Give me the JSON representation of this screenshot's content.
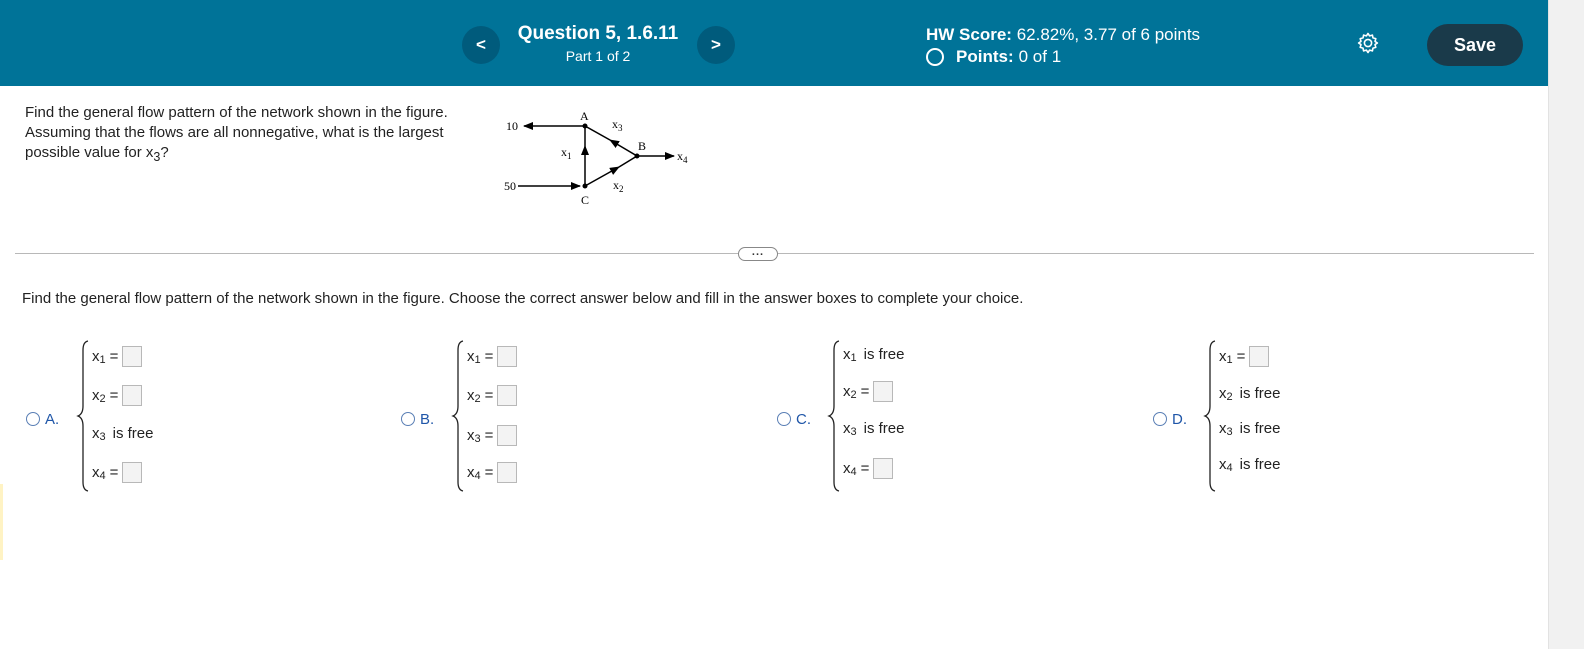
{
  "header": {
    "prev_label": "<",
    "next_label": ">",
    "question_title": "Question 5, 1.6.11",
    "question_part": "Part 1 of 2",
    "hw_score_label": "HW Score:",
    "hw_score_value": "62.82%, 3.77 of 6 points",
    "points_label": "Points:",
    "points_value": "0 of 1",
    "save_label": "Save",
    "colors": {
      "bar": "#007398",
      "save": "#1a3a4a"
    }
  },
  "question": {
    "text_main": "Find the general flow pattern of the network shown in the figure. Assuming that the flows are all nonnegative, what is the largest possible value for x",
    "text_sub": "3",
    "text_end": "?"
  },
  "figure": {
    "labels": {
      "A": "A",
      "B": "B",
      "C": "C",
      "in_top": "10",
      "in_bottom": "50",
      "x1": "x",
      "x1_sub": "1",
      "x2": "x",
      "x2_sub": "2",
      "x3": "x",
      "x3_sub": "3",
      "x4": "x",
      "x4_sub": "4"
    }
  },
  "divider": {
    "ellipsis": "..."
  },
  "instruction": "Find the general flow pattern of the network shown in the figure. Choose the correct answer below and fill in the answer boxes to complete your choice.",
  "choices": [
    {
      "letter": "A.",
      "rows": [
        {
          "var": "x",
          "sub": "1",
          "kind": "input",
          "text": "="
        },
        {
          "var": "x",
          "sub": "2",
          "kind": "input",
          "text": "="
        },
        {
          "var": "x",
          "sub": "3",
          "kind": "free",
          "text": "is free"
        },
        {
          "var": "x",
          "sub": "4",
          "kind": "input",
          "text": "="
        }
      ]
    },
    {
      "letter": "B.",
      "rows": [
        {
          "var": "x",
          "sub": "1",
          "kind": "input",
          "text": "="
        },
        {
          "var": "x",
          "sub": "2",
          "kind": "input",
          "text": "="
        },
        {
          "var": "x",
          "sub": "3",
          "kind": "input",
          "text": "="
        },
        {
          "var": "x",
          "sub": "4",
          "kind": "input",
          "text": "="
        }
      ]
    },
    {
      "letter": "C.",
      "rows": [
        {
          "var": "x",
          "sub": "1",
          "kind": "free",
          "text": "is free"
        },
        {
          "var": "x",
          "sub": "2",
          "kind": "input",
          "text": "="
        },
        {
          "var": "x",
          "sub": "3",
          "kind": "free",
          "text": "is free"
        },
        {
          "var": "x",
          "sub": "4",
          "kind": "input",
          "text": "="
        }
      ]
    },
    {
      "letter": "D.",
      "rows": [
        {
          "var": "x",
          "sub": "1",
          "kind": "input",
          "text": "="
        },
        {
          "var": "x",
          "sub": "2",
          "kind": "free",
          "text": "is free"
        },
        {
          "var": "x",
          "sub": "3",
          "kind": "free",
          "text": "is free"
        },
        {
          "var": "x",
          "sub": "4",
          "kind": "free",
          "text": "is free"
        }
      ]
    }
  ]
}
